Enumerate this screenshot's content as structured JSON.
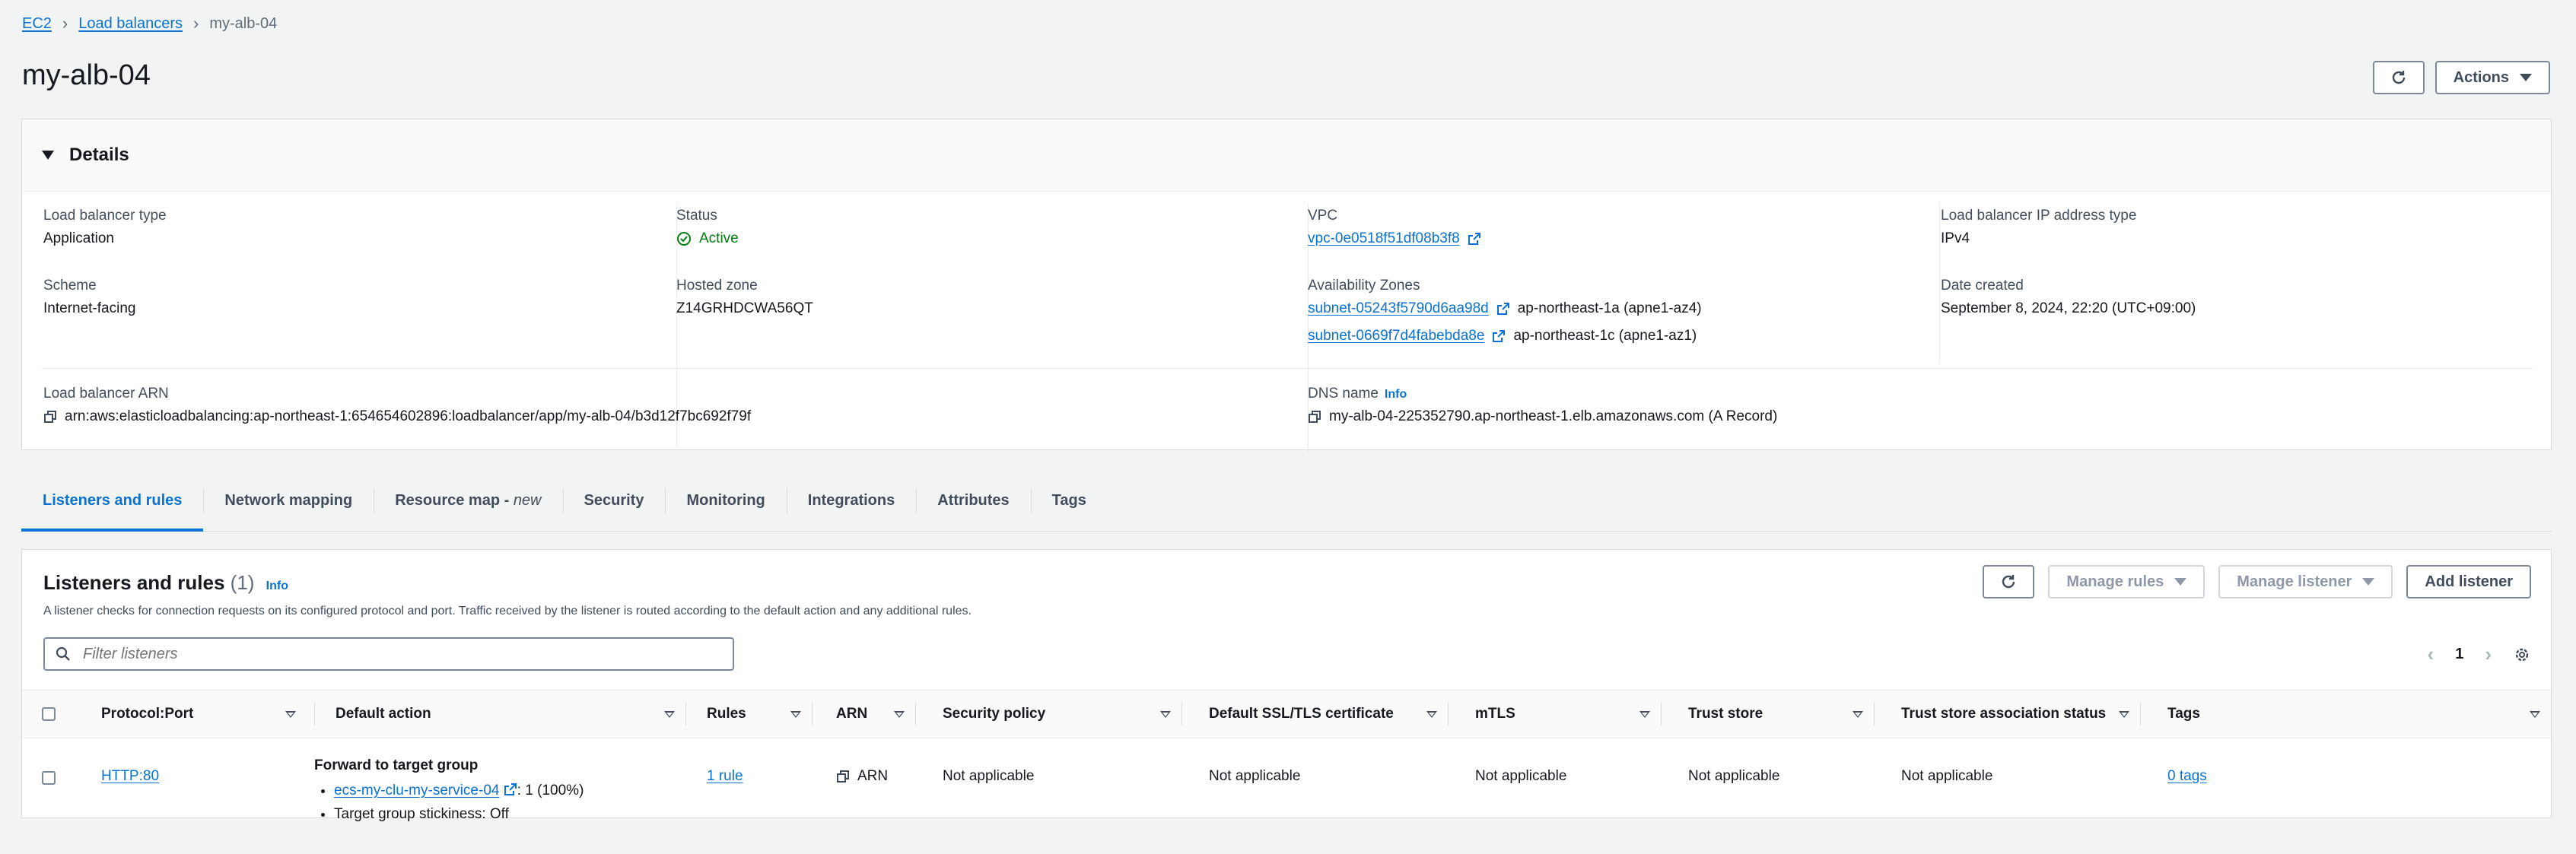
{
  "breadcrumb": {
    "root": "EC2",
    "parent": "Load balancers",
    "current": "my-alb-04"
  },
  "page": {
    "title": "my-alb-04",
    "actions_label": "Actions"
  },
  "details": {
    "heading": "Details",
    "lb_type_label": "Load balancer type",
    "lb_type": "Application",
    "status_label": "Status",
    "status": "Active",
    "vpc_label": "VPC",
    "vpc": "vpc-0e0518f51df08b3f8",
    "ip_type_label": "Load balancer IP address type",
    "ip_type": "IPv4",
    "scheme_label": "Scheme",
    "scheme": "Internet-facing",
    "hosted_zone_label": "Hosted zone",
    "hosted_zone": "Z14GRHDCWA56QT",
    "az_label": "Availability Zones",
    "az": [
      {
        "subnet": "subnet-05243f5790d6aa98d",
        "zone": "ap-northeast-1a (apne1-az4)"
      },
      {
        "subnet": "subnet-0669f7d4fabebda8e",
        "zone": "ap-northeast-1c (apne1-az1)"
      }
    ],
    "date_label": "Date created",
    "date": "September 8, 2024, 22:20 (UTC+09:00)",
    "arn_label": "Load balancer ARN",
    "arn": "arn:aws:elasticloadbalancing:ap-northeast-1:654654602896:loadbalancer/app/my-alb-04/b3d12f7bc692f79f",
    "dns_label": "DNS name",
    "dns_info": "Info",
    "dns": "my-alb-04-225352790.ap-northeast-1.elb.amazonaws.com (A Record)"
  },
  "tabs": {
    "listeners": "Listeners and rules",
    "network": "Network mapping",
    "resource_map": "Resource map - ",
    "resource_map_new": "new",
    "security": "Security",
    "monitoring": "Monitoring",
    "integrations": "Integrations",
    "attributes": "Attributes",
    "tags": "Tags"
  },
  "listeners": {
    "title": "Listeners and rules",
    "count": "(1)",
    "info": "Info",
    "description": "A listener checks for connection requests on its configured protocol and port. Traffic received by the listener is routed according to the default action and any additional rules.",
    "manage_rules": "Manage rules",
    "manage_listener": "Manage listener",
    "add_listener": "Add listener",
    "filter_placeholder": "Filter listeners",
    "page": "1",
    "columns": {
      "protocol": "Protocol:Port",
      "default_action": "Default action",
      "rules": "Rules",
      "arn": "ARN",
      "security_policy": "Security policy",
      "ssl_cert": "Default SSL/TLS certificate",
      "mtls": "mTLS",
      "trust_store": "Trust store",
      "trust_status": "Trust store association status",
      "tags": "Tags"
    },
    "row": {
      "protocol": "HTTP:80",
      "action_title": "Forward to target group",
      "target_group": "ecs-my-clu-my-service-04",
      "target_weight": ": 1 (100%)",
      "stickiness": "Target group stickiness: Off",
      "rules": "1 rule",
      "arn": "ARN",
      "security_policy": "Not applicable",
      "ssl_cert": "Not applicable",
      "mtls": "Not applicable",
      "trust_store": "Not applicable",
      "trust_status": "Not applicable",
      "tags": "0 tags"
    }
  },
  "colors": {
    "link": "#0972d3",
    "active": "#037f0c",
    "border": "#d5dbdb"
  }
}
